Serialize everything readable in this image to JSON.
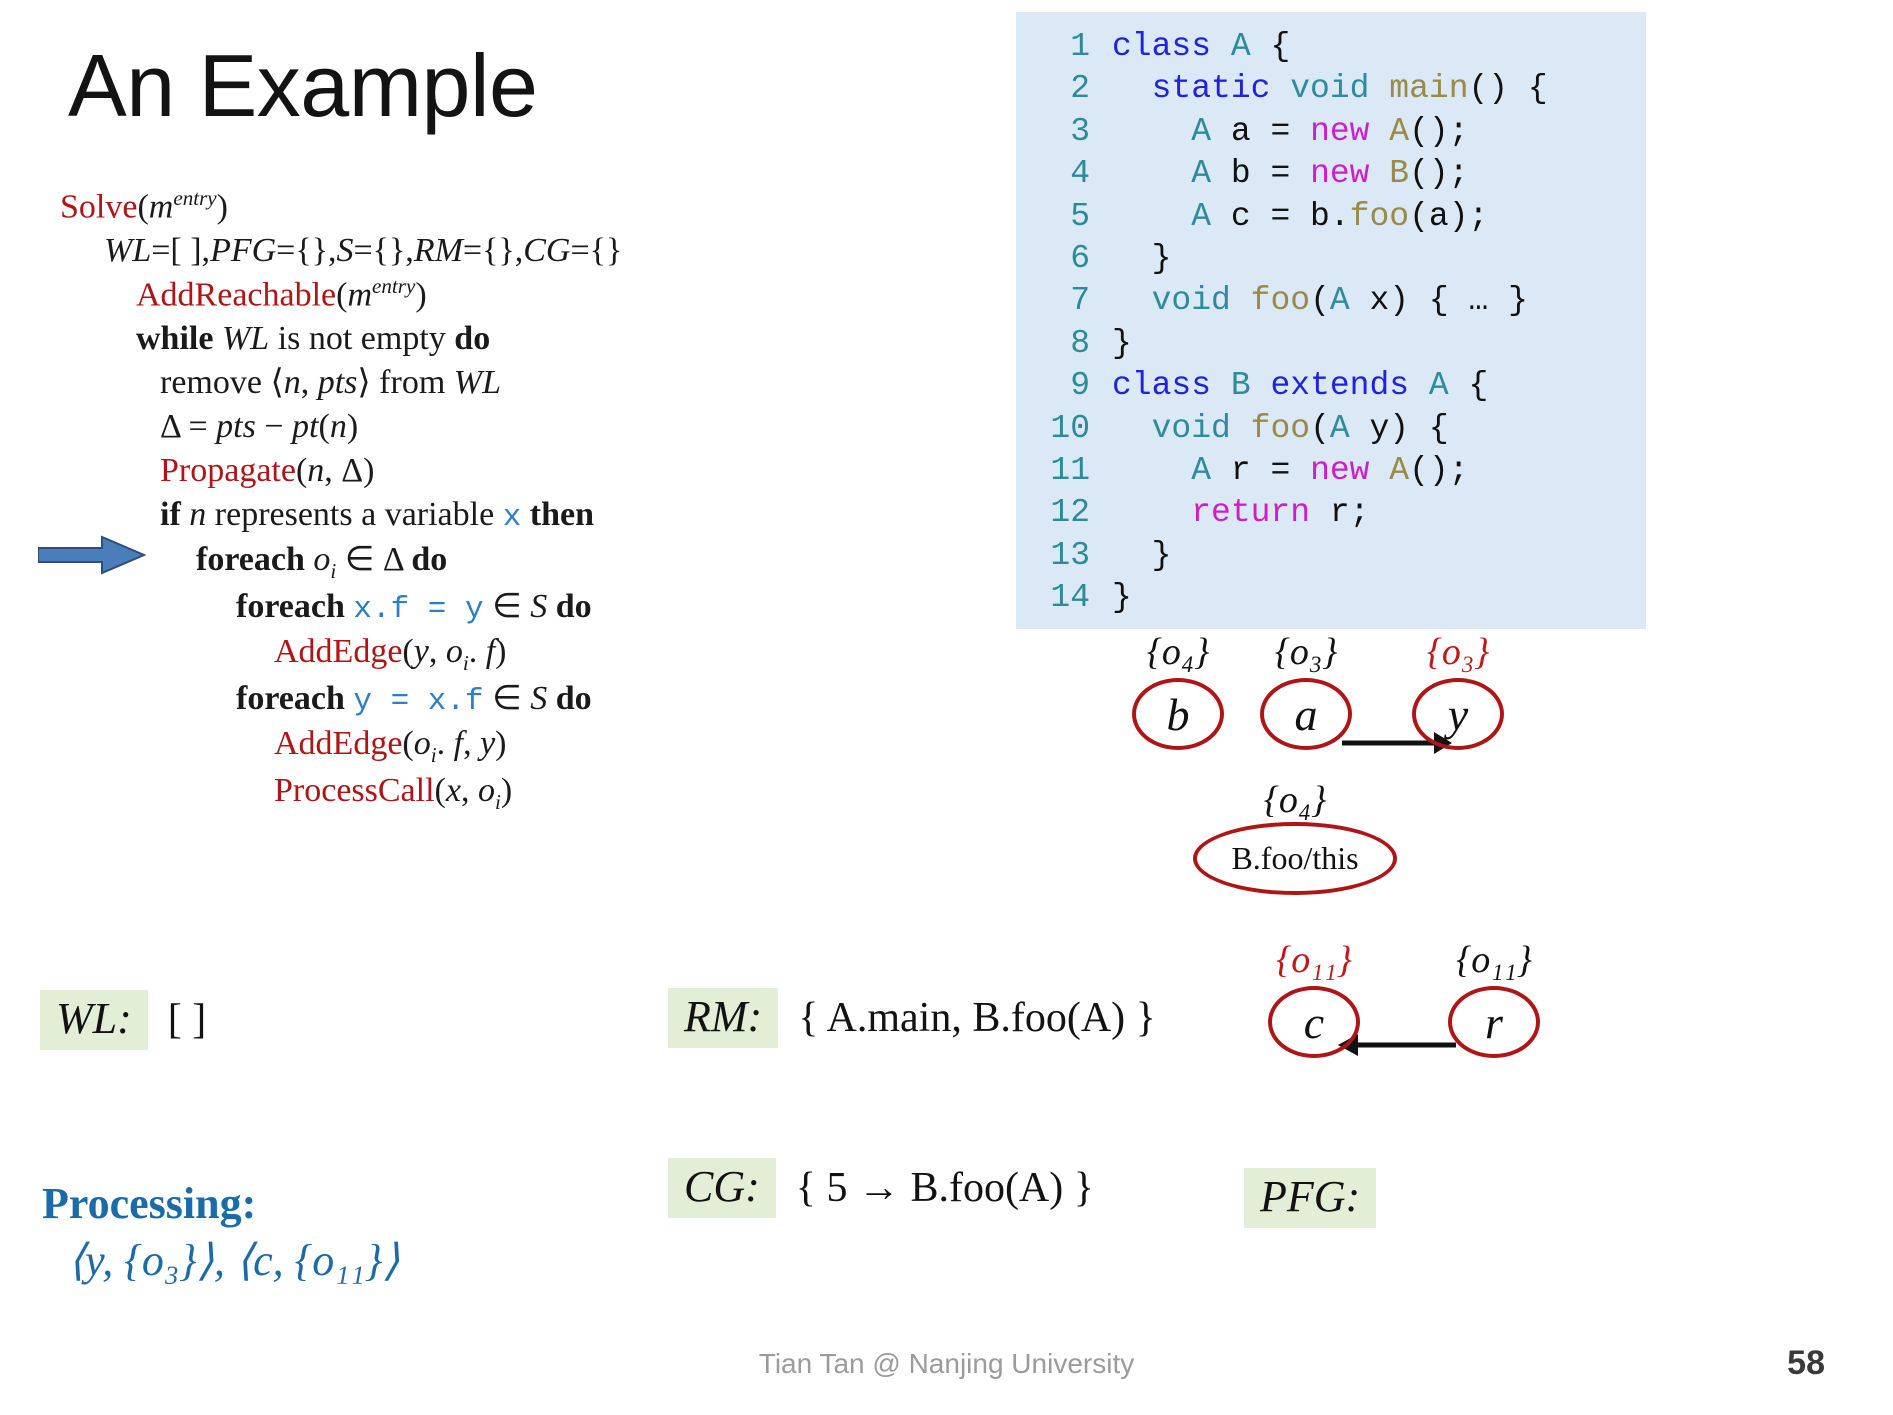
{
  "slide": {
    "title": "An Example",
    "footer": "Tian Tan @ Nanjing University",
    "page_number": "58"
  },
  "algorithm": {
    "name": "Solve",
    "lines": [
      "Solve(m^entry)",
      "WL=[ ],PFG={},S={},RM={},CG={}",
      "AddReachable(m^entry)",
      "while WL is not empty do",
      "remove ⟨n, pts⟩ from WL",
      "Δ = pts − pt(n)",
      "Propagate(n, Δ)",
      "if n represents a variable x then",
      "foreach o_i ∈ Δ do",
      "foreach x.f = y ∈ S do",
      "AddEdge(y, o_i. f)",
      "foreach y = x.f ∈ S do",
      "AddEdge(o_i. f, y)",
      "ProcessCall(x, o_i)"
    ],
    "highlighted_line": "Propagate(n, Δ)",
    "arrow_target": "Propagate(n, Δ)"
  },
  "code_panel": {
    "background": "#dbe9f6",
    "lines": [
      {
        "n": "1",
        "text": "class A {"
      },
      {
        "n": "2",
        "text": "  static void main() {"
      },
      {
        "n": "3",
        "text": "    A a = new A();"
      },
      {
        "n": "4",
        "text": "    A b = new B();"
      },
      {
        "n": "5",
        "text": "    A c = b.foo(a);"
      },
      {
        "n": "6",
        "text": "  }"
      },
      {
        "n": "7",
        "text": "  void foo(A x) { … }"
      },
      {
        "n": "8",
        "text": "}"
      },
      {
        "n": "9",
        "text": "class B extends A {"
      },
      {
        "n": "10",
        "text": "  void foo(A y) {"
      },
      {
        "n": "11",
        "text": "    A r = new A();"
      },
      {
        "n": "12",
        "text": "    return r;"
      },
      {
        "n": "13",
        "text": "  }"
      },
      {
        "n": "14",
        "text": "}"
      }
    ]
  },
  "state": {
    "wl": {
      "label": "WL:",
      "value": "[ ]"
    },
    "rm": {
      "label": "RM:",
      "value": "{ A.main, B.foo(A) }"
    },
    "cg": {
      "label": "CG:",
      "value": "{ 5 → B.foo(A) }"
    },
    "pfg": {
      "label": "PFG:"
    },
    "processing": {
      "label": "Processing:",
      "value": "⟨y, {o₃}⟩, ⟨c, {o₁₁}⟩"
    }
  },
  "pfg_graph": {
    "nodes": [
      {
        "id": "b",
        "label": "b",
        "ptset": "{o₄}",
        "ptset_red": false
      },
      {
        "id": "a",
        "label": "a",
        "ptset": "{o₃}",
        "ptset_red": false
      },
      {
        "id": "y",
        "label": "y",
        "ptset": "{o₃}",
        "ptset_red": true
      },
      {
        "id": "bfoothis",
        "label": "B.foo/this",
        "ptset": "{o₄}",
        "ptset_red": false
      },
      {
        "id": "c",
        "label": "c",
        "ptset": "{o₁₁}",
        "ptset_red": true
      },
      {
        "id": "r",
        "label": "r",
        "ptset": "{o₁₁}",
        "ptset_red": false
      }
    ],
    "edges": [
      {
        "from": "a",
        "to": "y"
      },
      {
        "from": "r",
        "to": "c"
      }
    ]
  },
  "colors": {
    "accent_red": "#b01515",
    "accent_blue": "#2b7fc4",
    "code_bg": "#dbe9f6",
    "tag_bg": "#e2eed6",
    "processing_blue": "#1a6ba8",
    "arrow_blue": "#4a7ebb"
  }
}
